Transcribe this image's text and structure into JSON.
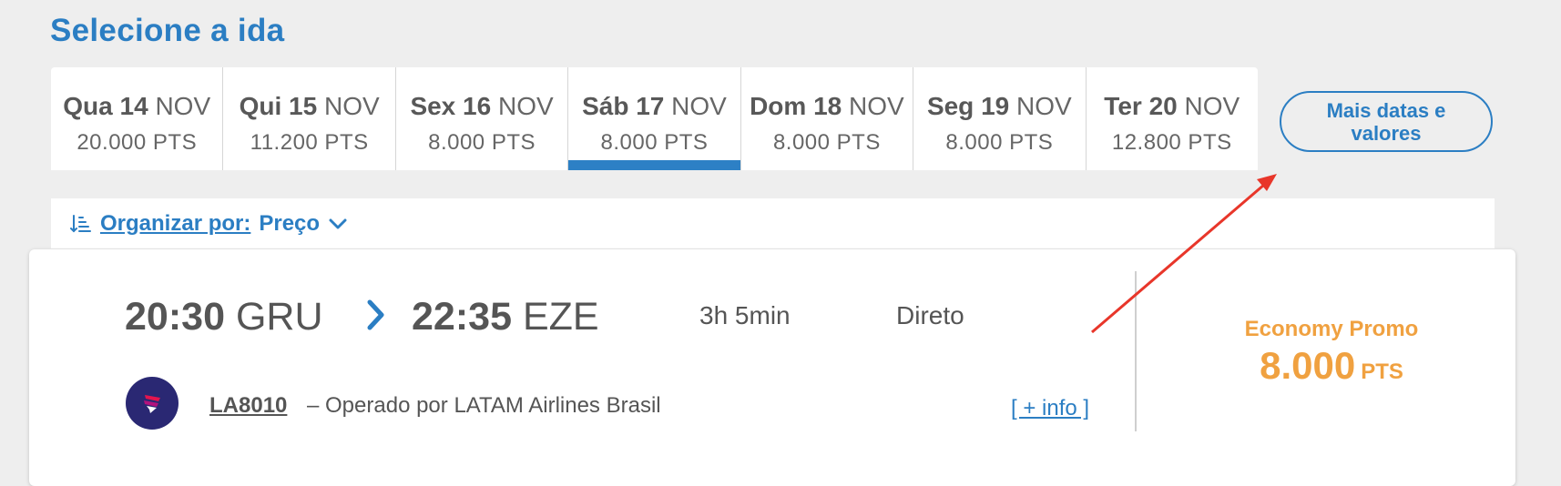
{
  "page_title": "Selecione a ida",
  "date_tabs": [
    {
      "day": "Qua 14",
      "month": "NOV",
      "points": "20.000 PTS",
      "selected": false
    },
    {
      "day": "Qui 15",
      "month": "NOV",
      "points": "11.200 PTS",
      "selected": false
    },
    {
      "day": "Sex 16",
      "month": "NOV",
      "points": "8.000 PTS",
      "selected": false
    },
    {
      "day": "Sáb 17",
      "month": "NOV",
      "points": "8.000 PTS",
      "selected": true
    },
    {
      "day": "Dom 18",
      "month": "NOV",
      "points": "8.000 PTS",
      "selected": false
    },
    {
      "day": "Seg 19",
      "month": "NOV",
      "points": "8.000 PTS",
      "selected": false
    },
    {
      "day": "Ter 20",
      "month": "NOV",
      "points": "12.800 PTS",
      "selected": false
    }
  ],
  "more_dates_label": "Mais datas e valores",
  "sort": {
    "icon": "sort-icon",
    "label": "Organizar por:",
    "value": "Preço",
    "chevron": "chevron-down-icon"
  },
  "flight": {
    "departure_time": "20:30",
    "departure_airport": "GRU",
    "arrival_time": "22:35",
    "arrival_airport": "EZE",
    "duration": "3h 5min",
    "stops": "Direto",
    "flight_number": "LA8010",
    "operated_by": "– Operado por LATAM Airlines Brasil",
    "info_link": "[ + info ]",
    "fare_class": "Economy Promo",
    "fare_points": "8.000",
    "fare_unit": "PTS"
  },
  "colors": {
    "accent": "#2b7ec3",
    "fare": "#f0a140",
    "annotation_arrow": "#e8362a",
    "airline_logo_bg": "#2a2873"
  }
}
